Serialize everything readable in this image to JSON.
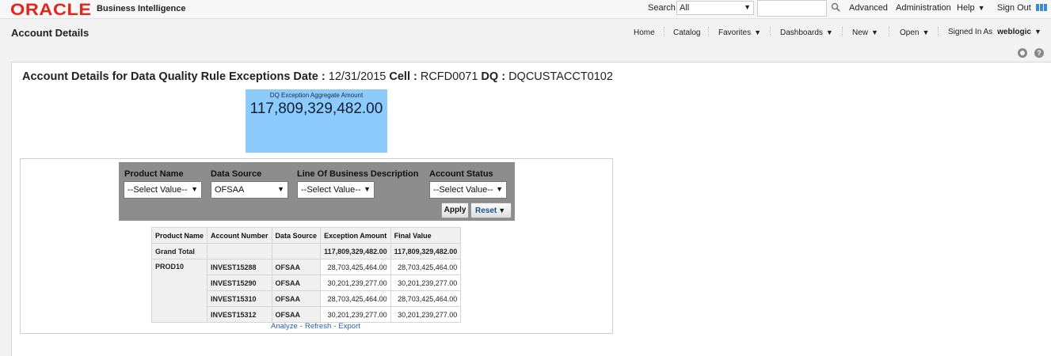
{
  "header": {
    "logo": "ORACLE",
    "product": "Business Intelligence",
    "search_label": "Search",
    "search_scope": "All",
    "search_value": "",
    "advanced": "Advanced",
    "administration": "Administration",
    "help": "Help",
    "sign_out": "Sign Out"
  },
  "nav": {
    "page_title": "Account Details",
    "home": "Home",
    "catalog": "Catalog",
    "favorites": "Favorites",
    "dashboards": "Dashboards",
    "new": "New",
    "open": "Open",
    "signed_in_as": "Signed In As",
    "user": "weblogic"
  },
  "report": {
    "title_prefix": "Account Details for Data Quality Rule Exceptions Date :",
    "date": "12/31/2015",
    "cell_label": "Cell :",
    "cell": "RCFD0071",
    "dq_label": "DQ :",
    "dq": "DQCUSTACCT0102",
    "tile_label": "DQ Exception Aggregate Amount",
    "tile_value": "117,809,329,482.00"
  },
  "prompts": {
    "product_name": {
      "label": "Product Name",
      "value": "--Select Value--"
    },
    "data_source": {
      "label": "Data Source",
      "value": "OFSAA"
    },
    "lob": {
      "label": "Line Of Business Description",
      "value": "--Select Value--"
    },
    "account_status": {
      "label": "Account Status",
      "value": "--Select Value--"
    },
    "apply": "Apply",
    "reset": "Reset"
  },
  "table": {
    "headers": [
      "Product Name",
      "Account Number",
      "Data Source",
      "Exception Amount",
      "Final Value"
    ],
    "grand_total": {
      "label": "Grand Total",
      "exception_amount": "117,809,329,482.00",
      "final_value": "117,809,329,482.00"
    },
    "product": "PROD10",
    "rows": [
      {
        "account": "INVEST15288",
        "source": "OFSAA",
        "exception_amount": "28,703,425,464.00",
        "final_value": "28,703,425,464.00"
      },
      {
        "account": "INVEST15290",
        "source": "OFSAA",
        "exception_amount": "30,201,239,277.00",
        "final_value": "30,201,239,277.00"
      },
      {
        "account": "INVEST15310",
        "source": "OFSAA",
        "exception_amount": "28,703,425,464.00",
        "final_value": "28,703,425,464.00"
      },
      {
        "account": "INVEST15312",
        "source": "OFSAA",
        "exception_amount": "30,201,239,277.00",
        "final_value": "30,201,239,277.00"
      }
    ]
  },
  "links": {
    "analyze": "Analyze",
    "refresh": "Refresh",
    "export": "Export",
    "separator": "-"
  },
  "colors": {
    "oracle_red": "#e3251a",
    "tile_blue": "#8ccbfb",
    "prompt_bg": "#8d8d8d",
    "link_blue": "#2a5ea8"
  }
}
